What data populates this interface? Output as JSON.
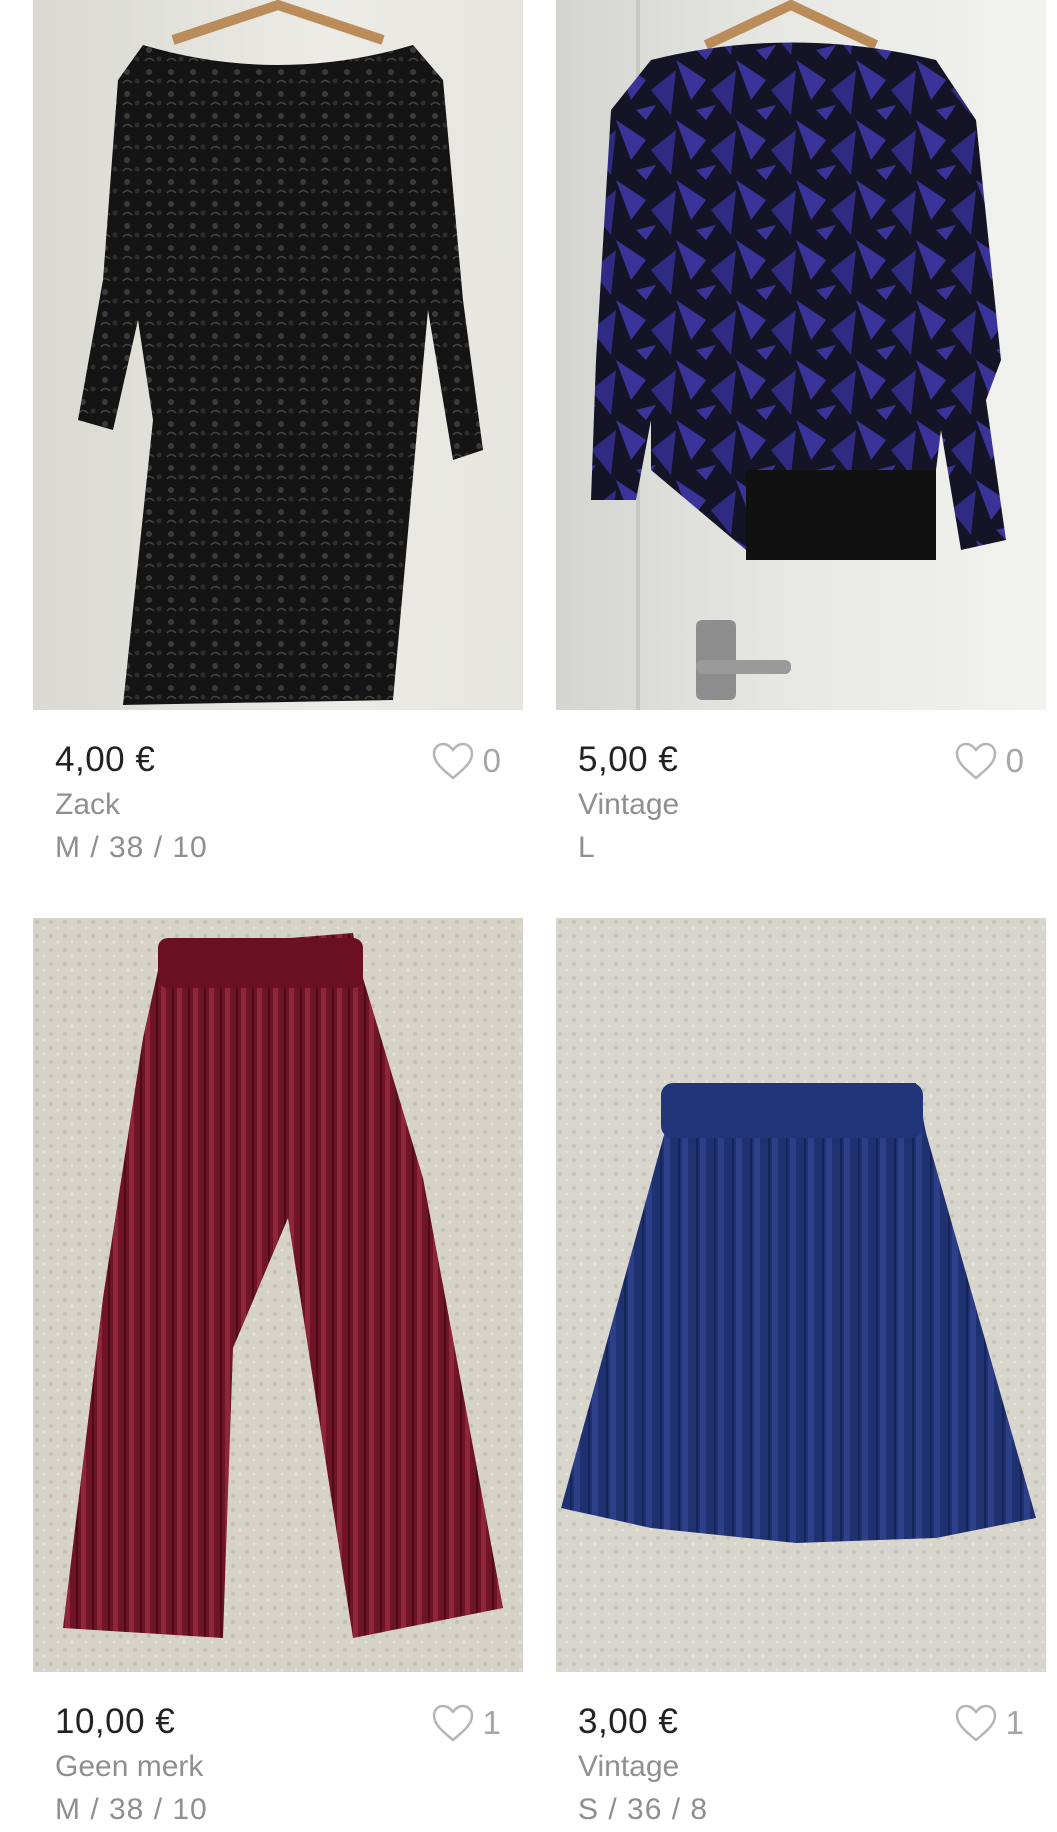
{
  "listings": [
    {
      "price": "4,00 €",
      "brand": "Zack",
      "size": "M / 38 / 10",
      "favorites": "0",
      "photo_icon": "lace-dress-photo",
      "item_color": "#111111"
    },
    {
      "price": "5,00 €",
      "brand": "Vintage",
      "size": "L",
      "favorites": "0",
      "photo_icon": "sweater-photo",
      "item_color": "#2d2a7a"
    },
    {
      "price": "10,00 €",
      "brand": "Geen merk",
      "size": "M / 38 / 10",
      "favorites": "1",
      "photo_icon": "velvet-trousers-photo",
      "item_color": "#7a1a2e"
    },
    {
      "price": "3,00 €",
      "brand": "Vintage",
      "size": "S / 36 / 8",
      "favorites": "1",
      "photo_icon": "pleated-skirt-photo",
      "item_color": "#1e2f6e"
    }
  ],
  "icons": {
    "favorite": "heart-outline-icon"
  },
  "colors": {
    "price_text": "#222222",
    "meta_text": "#8f8f8f",
    "heart_outline": "#b5b5b5",
    "background": "#ffffff"
  }
}
